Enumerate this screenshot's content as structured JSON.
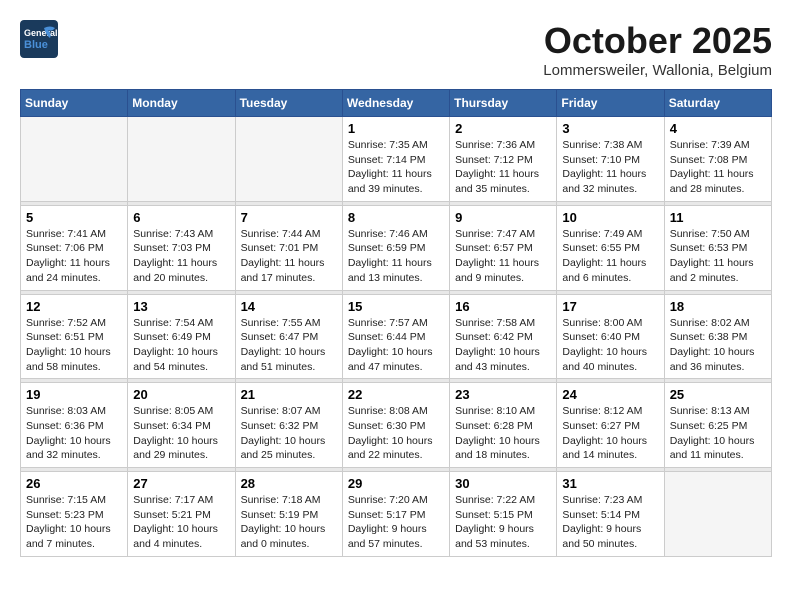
{
  "header": {
    "logo_text_general": "General",
    "logo_text_blue": "Blue",
    "month_title": "October 2025",
    "location": "Lommersweiler, Wallonia, Belgium"
  },
  "weekdays": [
    "Sunday",
    "Monday",
    "Tuesday",
    "Wednesday",
    "Thursday",
    "Friday",
    "Saturday"
  ],
  "weeks": [
    [
      {
        "day": "",
        "info": ""
      },
      {
        "day": "",
        "info": ""
      },
      {
        "day": "",
        "info": ""
      },
      {
        "day": "1",
        "info": "Sunrise: 7:35 AM\nSunset: 7:14 PM\nDaylight: 11 hours\nand 39 minutes."
      },
      {
        "day": "2",
        "info": "Sunrise: 7:36 AM\nSunset: 7:12 PM\nDaylight: 11 hours\nand 35 minutes."
      },
      {
        "day": "3",
        "info": "Sunrise: 7:38 AM\nSunset: 7:10 PM\nDaylight: 11 hours\nand 32 minutes."
      },
      {
        "day": "4",
        "info": "Sunrise: 7:39 AM\nSunset: 7:08 PM\nDaylight: 11 hours\nand 28 minutes."
      }
    ],
    [
      {
        "day": "5",
        "info": "Sunrise: 7:41 AM\nSunset: 7:06 PM\nDaylight: 11 hours\nand 24 minutes."
      },
      {
        "day": "6",
        "info": "Sunrise: 7:43 AM\nSunset: 7:03 PM\nDaylight: 11 hours\nand 20 minutes."
      },
      {
        "day": "7",
        "info": "Sunrise: 7:44 AM\nSunset: 7:01 PM\nDaylight: 11 hours\nand 17 minutes."
      },
      {
        "day": "8",
        "info": "Sunrise: 7:46 AM\nSunset: 6:59 PM\nDaylight: 11 hours\nand 13 minutes."
      },
      {
        "day": "9",
        "info": "Sunrise: 7:47 AM\nSunset: 6:57 PM\nDaylight: 11 hours\nand 9 minutes."
      },
      {
        "day": "10",
        "info": "Sunrise: 7:49 AM\nSunset: 6:55 PM\nDaylight: 11 hours\nand 6 minutes."
      },
      {
        "day": "11",
        "info": "Sunrise: 7:50 AM\nSunset: 6:53 PM\nDaylight: 11 hours\nand 2 minutes."
      }
    ],
    [
      {
        "day": "12",
        "info": "Sunrise: 7:52 AM\nSunset: 6:51 PM\nDaylight: 10 hours\nand 58 minutes."
      },
      {
        "day": "13",
        "info": "Sunrise: 7:54 AM\nSunset: 6:49 PM\nDaylight: 10 hours\nand 54 minutes."
      },
      {
        "day": "14",
        "info": "Sunrise: 7:55 AM\nSunset: 6:47 PM\nDaylight: 10 hours\nand 51 minutes."
      },
      {
        "day": "15",
        "info": "Sunrise: 7:57 AM\nSunset: 6:44 PM\nDaylight: 10 hours\nand 47 minutes."
      },
      {
        "day": "16",
        "info": "Sunrise: 7:58 AM\nSunset: 6:42 PM\nDaylight: 10 hours\nand 43 minutes."
      },
      {
        "day": "17",
        "info": "Sunrise: 8:00 AM\nSunset: 6:40 PM\nDaylight: 10 hours\nand 40 minutes."
      },
      {
        "day": "18",
        "info": "Sunrise: 8:02 AM\nSunset: 6:38 PM\nDaylight: 10 hours\nand 36 minutes."
      }
    ],
    [
      {
        "day": "19",
        "info": "Sunrise: 8:03 AM\nSunset: 6:36 PM\nDaylight: 10 hours\nand 32 minutes."
      },
      {
        "day": "20",
        "info": "Sunrise: 8:05 AM\nSunset: 6:34 PM\nDaylight: 10 hours\nand 29 minutes."
      },
      {
        "day": "21",
        "info": "Sunrise: 8:07 AM\nSunset: 6:32 PM\nDaylight: 10 hours\nand 25 minutes."
      },
      {
        "day": "22",
        "info": "Sunrise: 8:08 AM\nSunset: 6:30 PM\nDaylight: 10 hours\nand 22 minutes."
      },
      {
        "day": "23",
        "info": "Sunrise: 8:10 AM\nSunset: 6:28 PM\nDaylight: 10 hours\nand 18 minutes."
      },
      {
        "day": "24",
        "info": "Sunrise: 8:12 AM\nSunset: 6:27 PM\nDaylight: 10 hours\nand 14 minutes."
      },
      {
        "day": "25",
        "info": "Sunrise: 8:13 AM\nSunset: 6:25 PM\nDaylight: 10 hours\nand 11 minutes."
      }
    ],
    [
      {
        "day": "26",
        "info": "Sunrise: 7:15 AM\nSunset: 5:23 PM\nDaylight: 10 hours\nand 7 minutes."
      },
      {
        "day": "27",
        "info": "Sunrise: 7:17 AM\nSunset: 5:21 PM\nDaylight: 10 hours\nand 4 minutes."
      },
      {
        "day": "28",
        "info": "Sunrise: 7:18 AM\nSunset: 5:19 PM\nDaylight: 10 hours\nand 0 minutes."
      },
      {
        "day": "29",
        "info": "Sunrise: 7:20 AM\nSunset: 5:17 PM\nDaylight: 9 hours\nand 57 minutes."
      },
      {
        "day": "30",
        "info": "Sunrise: 7:22 AM\nSunset: 5:15 PM\nDaylight: 9 hours\nand 53 minutes."
      },
      {
        "day": "31",
        "info": "Sunrise: 7:23 AM\nSunset: 5:14 PM\nDaylight: 9 hours\nand 50 minutes."
      },
      {
        "day": "",
        "info": ""
      }
    ]
  ]
}
